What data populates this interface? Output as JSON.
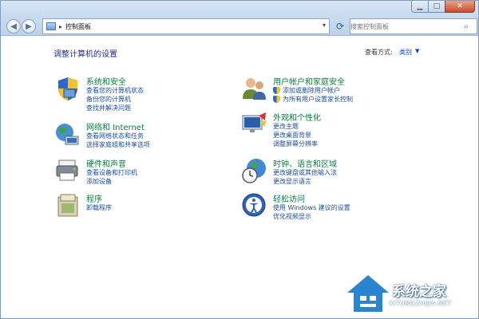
{
  "address": {
    "path": "控制面板"
  },
  "search": {
    "placeholder": "搜索控制面板"
  },
  "page": {
    "title": "调整计算机的设置",
    "view_by_label": "查看方式:",
    "view_by_value": "类别"
  },
  "categories": [
    {
      "title": "系统和安全",
      "icon": "system-security-icon",
      "links": [
        {
          "label": "查看您的计算机状态"
        },
        {
          "label": "备份您的计算机"
        },
        {
          "label": "查找并解决问题"
        }
      ]
    },
    {
      "title": "网络和 Internet",
      "icon": "network-internet-icon",
      "links": [
        {
          "label": "查看网络状态和任务"
        },
        {
          "label": "选择家庭组和共享选项"
        }
      ]
    },
    {
      "title": "硬件和声音",
      "icon": "hardware-sound-icon",
      "links": [
        {
          "label": "查看设备和打印机"
        },
        {
          "label": "添加设备"
        }
      ]
    },
    {
      "title": "程序",
      "icon": "programs-icon",
      "links": [
        {
          "label": "卸载程序"
        }
      ]
    },
    {
      "title": "用户帐户和家庭安全",
      "icon": "user-accounts-icon",
      "links": [
        {
          "label": "添加或删除用户帐户",
          "shield": true
        },
        {
          "label": "为所有用户设置家长控制",
          "shield": true
        }
      ]
    },
    {
      "title": "外观和个性化",
      "icon": "appearance-icon",
      "links": [
        {
          "label": "更改主题"
        },
        {
          "label": "更改桌面背景"
        },
        {
          "label": "调整屏幕分辨率"
        }
      ]
    },
    {
      "title": "时钟、语言和区域",
      "icon": "clock-language-icon",
      "links": [
        {
          "label": "更改键盘或其他输入法"
        },
        {
          "label": "更改显示语言"
        }
      ]
    },
    {
      "title": "轻松访问",
      "icon": "ease-of-access-icon",
      "links": [
        {
          "label": "使用 Windows 建议的设置"
        },
        {
          "label": "优化视频显示"
        }
      ]
    }
  ],
  "watermark": {
    "brand": "系统之家",
    "url": "XITONGZHIJIA.NET"
  },
  "colors": {
    "category_title": "#0a7f3f",
    "link": "#1a4d9d",
    "page_title": "#1e3287"
  }
}
